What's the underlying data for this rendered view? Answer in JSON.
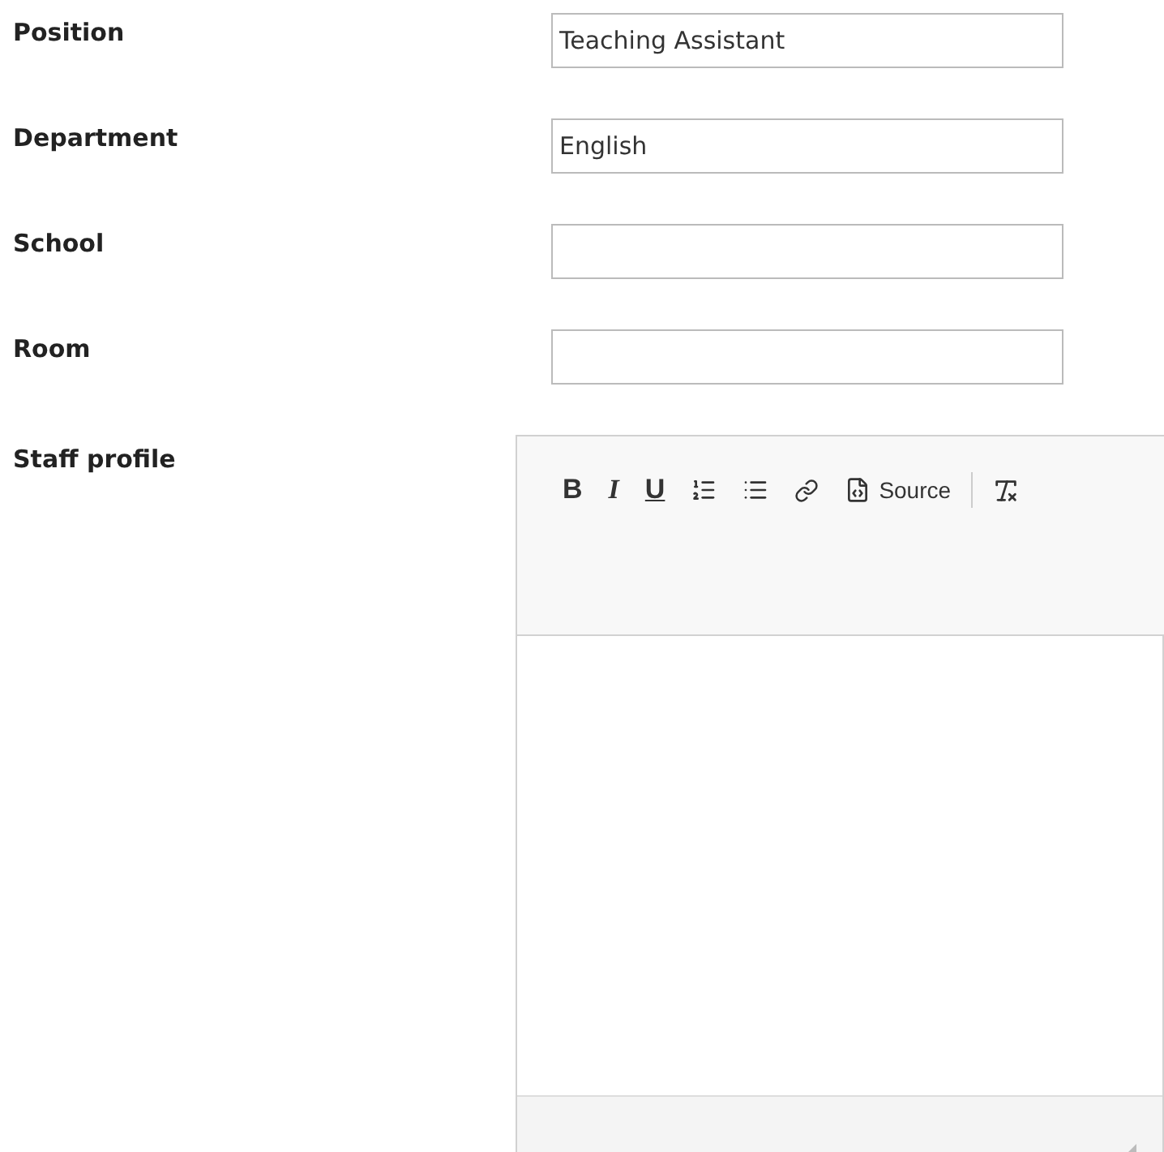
{
  "fields": [
    {
      "label": "Position",
      "value": "Teaching Assistant"
    },
    {
      "label": "Department",
      "value": "English"
    },
    {
      "label": "School"
    },
    {
      "label": "Room"
    }
  ],
  "editor": {
    "label": "Staff profile",
    "toolbar": [
      {
        "kind": "bold",
        "label": "B"
      },
      {
        "kind": "italic",
        "label": "I"
      },
      {
        "kind": "underline",
        "label": "U"
      },
      {
        "kind": "numbered-list"
      },
      {
        "kind": "bulleted-list"
      },
      {
        "kind": "link"
      },
      {
        "kind": "source",
        "label": "Source"
      },
      {
        "kind": "separator"
      },
      {
        "kind": "remove-format"
      }
    ]
  }
}
